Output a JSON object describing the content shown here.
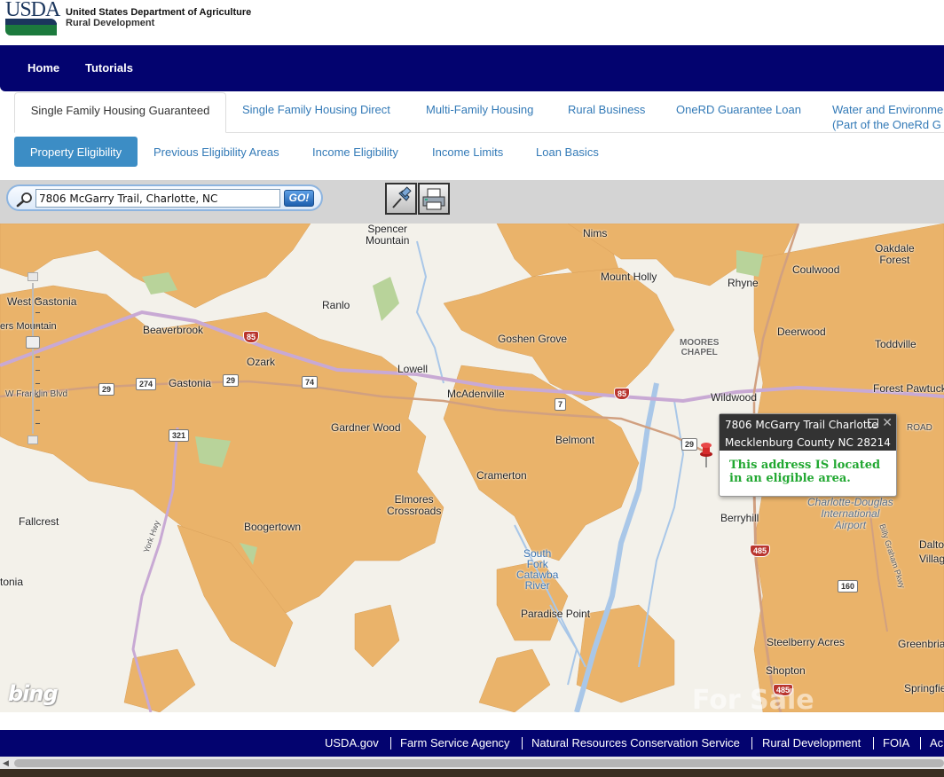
{
  "header": {
    "logo": "USDA",
    "agency_name": "United States Department of Agriculture",
    "agency_sub": "Rural Development"
  },
  "nav": {
    "items": [
      "Home",
      "Tutorials"
    ]
  },
  "tabs": [
    {
      "label": "Single Family Housing Guaranteed",
      "active": true
    },
    {
      "label": "Single Family Housing Direct"
    },
    {
      "label": "Multi-Family Housing"
    },
    {
      "label": "Rural Business"
    },
    {
      "label": "OneRD Guarantee Loan"
    },
    {
      "label": "Water and Environme",
      "label2": "(Part of the OneRd G"
    }
  ],
  "subtabs": [
    {
      "label": "Property Eligibility",
      "active": true
    },
    {
      "label": "Previous Eligibility Areas"
    },
    {
      "label": "Income Eligibility"
    },
    {
      "label": "Income Limits"
    },
    {
      "label": "Loan Basics"
    }
  ],
  "search": {
    "value": "7806 McGarry Trail, Charlotte, NC",
    "go_label": "GO!"
  },
  "toolbar_icons": [
    "pushpin-icon",
    "printer-icon"
  ],
  "map": {
    "places": [
      "Spencer",
      "Mountain",
      "Nims",
      "Oakdale",
      "Forest",
      "Coulwood",
      "Mount Holly",
      "Rhyne",
      "West Gastonia",
      "Ranlo",
      "ers Mountain",
      "Beaverbrook",
      "Goshen Grove",
      "MOORES",
      "CHAPEL",
      "Deerwood",
      "Toddville",
      "Ozark",
      "Lowell",
      "Gastonia",
      "McAdenville",
      "Wildwood",
      "Forest Pawtuck",
      "W Franklin Blvd",
      "Gardner Wood",
      "Belmont",
      "ROAD",
      "Cramerton",
      "Elmores",
      "Crossroads",
      "Fallcrest",
      "Boogertown",
      "Berryhill",
      "Charlotte-Douglas",
      "International",
      "Airport",
      "Dalto",
      "Villag",
      "South",
      "Fork",
      "Catawba",
      "River",
      "tonia",
      "Paradise Point",
      "Steelberry Acres",
      "Greenbria",
      "Shopton",
      "Springfie",
      "York Hwy",
      "Billy Graham Pkwy"
    ],
    "shields": [
      "85",
      "29",
      "274",
      "29",
      "74",
      "321",
      "7",
      "85",
      "29",
      "160",
      "485",
      "485"
    ],
    "attribution": "bing",
    "watermark": "For Sale",
    "eligible_color": "#eab36a",
    "ineligible_color": "#f3f1ea"
  },
  "popup": {
    "address_line1": "7806 McGarry Trail Charlotte",
    "address_line2": "Mecklenburg County NC 28214",
    "close": "✕",
    "status": "This address IS located in an eligible area."
  },
  "footer": {
    "links": [
      "USDA.gov",
      "Farm Service Agency",
      "Natural Resources Conservation Service",
      "Rural Development",
      "FOIA",
      "Ac"
    ]
  }
}
